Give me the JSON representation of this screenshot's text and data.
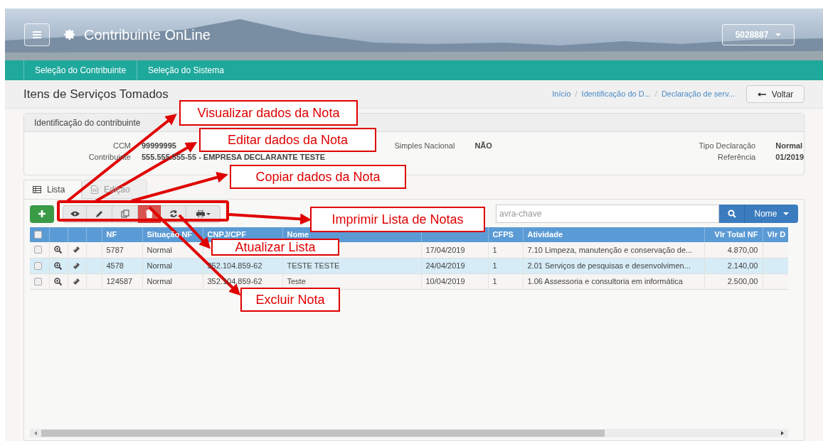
{
  "header": {
    "title": "Contribuinte OnLine",
    "user_menu": "5028887"
  },
  "nav": [
    "Seleção do Contribuinte",
    "Seleção do Sistema"
  ],
  "page_title": "Itens de Serviços Tomados",
  "breadcrumb": [
    {
      "kind": "link",
      "text": "Início"
    },
    {
      "kind": "separator",
      "text": "/"
    },
    {
      "kind": "link",
      "text": "Identificação do D..."
    },
    {
      "kind": "separator",
      "text": "/"
    },
    {
      "kind": "link",
      "text": "Declaração de serv..."
    }
  ],
  "back_button": "Voltar",
  "panel": {
    "title": "Identificação do contribuinte",
    "left_fields": [
      {
        "label": "CCM",
        "value": "99999995"
      },
      {
        "label": "Contribuinte",
        "value": "555.555.555-55 - EMPRESA DECLARANTE TESTE"
      }
    ],
    "middle_fields": [
      {
        "label": "Simples Nacional",
        "value": "NÃO"
      }
    ],
    "right_fields": [
      {
        "label": "Tipo Declaração",
        "value": "Normal"
      },
      {
        "label": "Referência",
        "value": "01/2019"
      }
    ]
  },
  "tabs": [
    {
      "label": "Lista",
      "selected": true,
      "disabled": false
    },
    {
      "label": "Edição",
      "selected": false,
      "disabled": true
    }
  ],
  "search": {
    "placeholder": "avra-chave",
    "filter": "Nome"
  },
  "table": {
    "select_all_checked": false,
    "headers": {
      "nf": "NF",
      "situacao": "Situação NF",
      "cnpj": "CNPJ/CPF",
      "nome": "Nome",
      "cfps": "CFPS",
      "atividade": "Atividade",
      "vlr_total": "Vlr Total NF",
      "vlr_d": "Vlr D"
    },
    "rows": [
      {
        "checked": false,
        "selected": false,
        "nf": "5787",
        "situacao": "Normal",
        "data_emissao": "17/04/2019",
        "cfps": "1",
        "atividade": "7.10 Limpeza, manutenção e conservação de...",
        "vlr_total": "4.870,00"
      },
      {
        "checked": false,
        "selected": true,
        "nf": "4578",
        "situacao": "Normal",
        "cnpj": "352.104.859-62",
        "nome": "TESTE TESTE",
        "data_emissao": "24/04/2019",
        "cfps": "1",
        "atividade": "2.01 Serviços de pesquisas e desenvolvimen...",
        "vlr_total": "2.140,00"
      },
      {
        "checked": false,
        "selected": false,
        "nf": "124587",
        "situacao": "Normal",
        "cnpj": "352.104.859-62",
        "nome": "Teste",
        "data_emissao": "10/04/2019",
        "cfps": "1",
        "atividade": "1.06 Assessoria e consultoria em informática",
        "vlr_total": "2.500,00"
      }
    ]
  },
  "callouts": [
    {
      "text": "Visualizar dados da Nota"
    },
    {
      "text": "Editar dados da Nota"
    },
    {
      "text": "Copiar dados da Nota"
    },
    {
      "text": "Imprimir Lista de Notas"
    },
    {
      "text": "Atualizar Lista"
    },
    {
      "text": "Excluir Nota"
    }
  ]
}
